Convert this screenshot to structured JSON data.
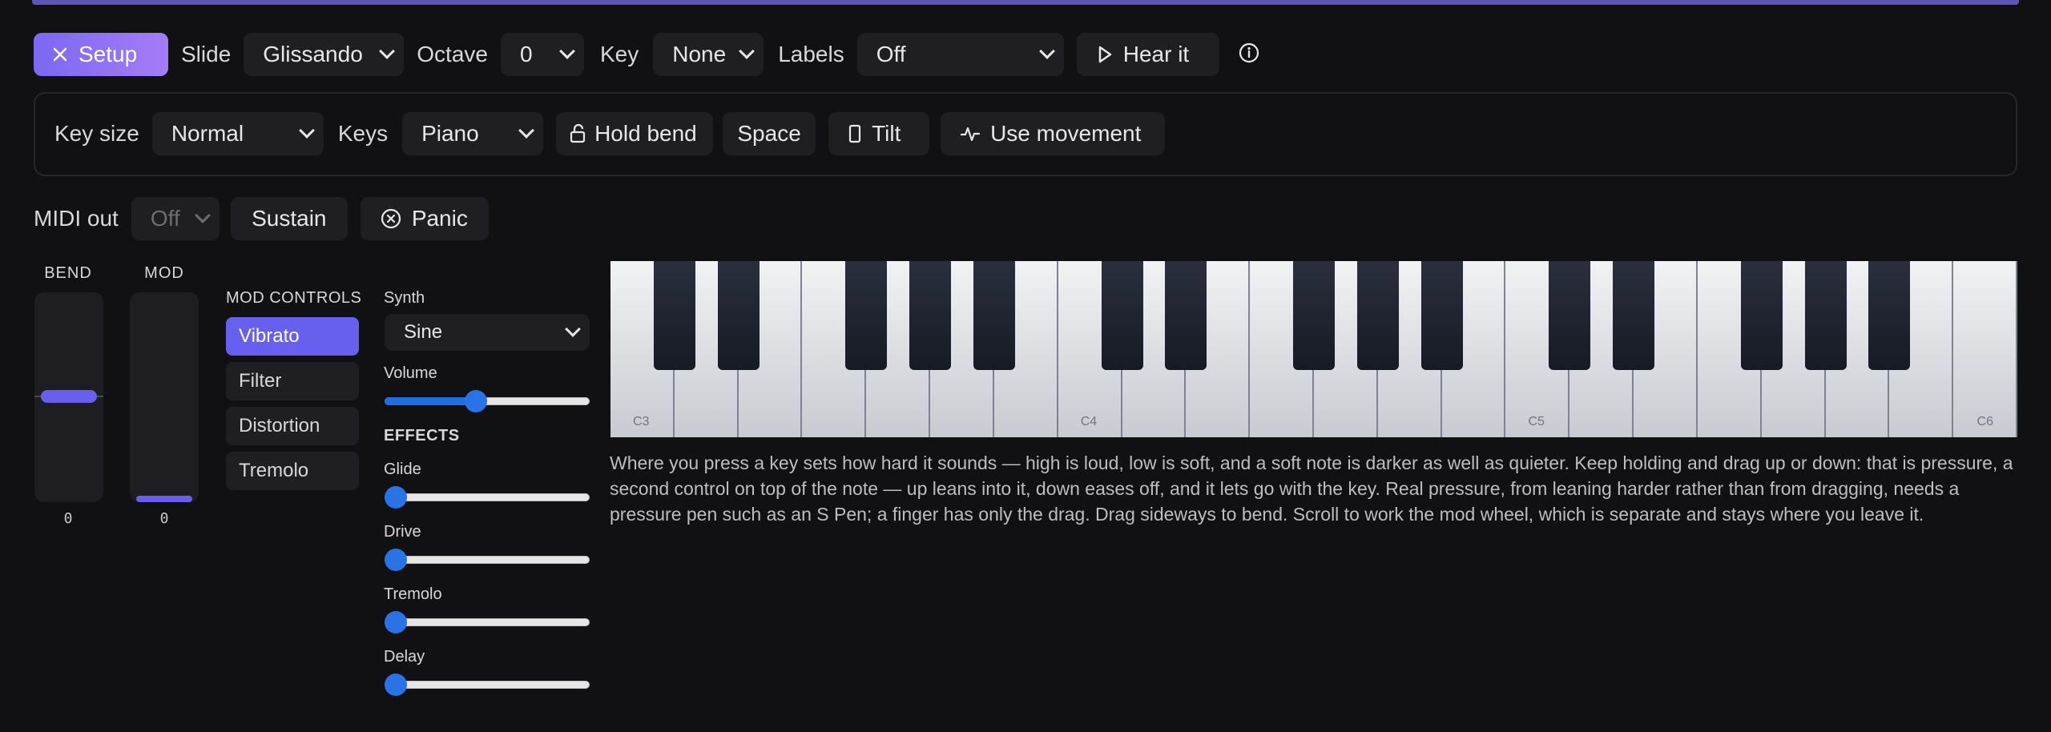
{
  "toolbar": {
    "setup_label": "Setup",
    "slide_label": "Slide",
    "slide_value": "Glissando",
    "octave_label": "Octave",
    "octave_value": "0",
    "key_label": "Key",
    "key_value": "None",
    "labels_label": "Labels",
    "labels_value": "Off",
    "hear_label": "Hear it"
  },
  "panel": {
    "keysize_label": "Key size",
    "keysize_value": "Normal",
    "keys_label": "Keys",
    "keys_value": "Piano",
    "holdbend_label": "Hold bend",
    "space_label": "Space",
    "tilt_label": "Tilt",
    "movement_label": "Use movement"
  },
  "midi": {
    "label": "MIDI out",
    "value": "Off",
    "sustain_label": "Sustain",
    "panic_label": "Panic"
  },
  "wheels": {
    "bend_label": "BEND",
    "bend_value": "0",
    "mod_label": "MOD",
    "mod_value": "0"
  },
  "mod_controls": {
    "title": "MOD CONTROLS",
    "items": [
      "Vibrato",
      "Filter",
      "Distortion",
      "Tremolo"
    ],
    "active": "Vibrato"
  },
  "synth": {
    "label": "Synth",
    "value": "Sine",
    "volume_label": "Volume",
    "volume": 0.44,
    "effects_title": "EFFECTS",
    "glide_label": "Glide",
    "glide": 0,
    "drive_label": "Drive",
    "drive": 0,
    "tremolo_label": "Tremolo",
    "tremolo": 0,
    "delay_label": "Delay",
    "delay": 0
  },
  "keyboard": {
    "note_labels": [
      "C3",
      "C4",
      "C5",
      "C6"
    ]
  },
  "help_text": "Where you press a key sets how hard it sounds — high is loud, low is soft, and a soft note is darker as well as quieter. Keep holding and drag up or down: that is pressure, a second control on top of the note — up leans into it, down eases off, and it lets go with the key. Real pressure, from leaning harder rather than from dragging, needs a pressure pen such as an S Pen; a finger has only the drag. Drag sideways to bend. Scroll to work the mod wheel, which is separate and stays where you leave it.",
  "colors": {
    "accent": "#6760ee",
    "background": "#111113",
    "control": "#1f1f23",
    "slider": "#2a73e6"
  }
}
